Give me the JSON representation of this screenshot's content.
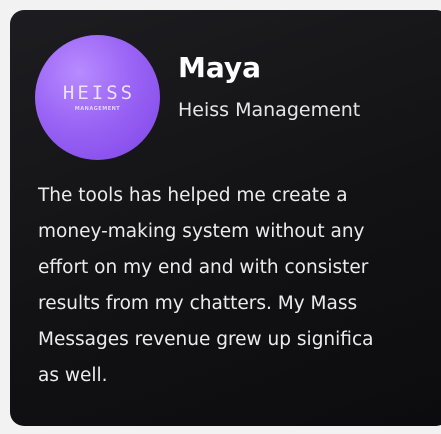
{
  "card": {
    "avatar": {
      "logo_text": "HEISS",
      "logo_subtext": "MANAGEMENT"
    },
    "name": "Maya",
    "company": "Heiss Management",
    "quote_lines": [
      "The tools has helped me create a",
      "money-making system without any",
      "effort on my end and with consister",
      "results from my chatters. My Mass",
      "Messages revenue grew up significa",
      "as well."
    ]
  },
  "colors": {
    "card_background": "#121214",
    "avatar_purple": "#9a64f5",
    "text_primary": "#ffffff",
    "text_secondary": "#e6e6e6"
  }
}
